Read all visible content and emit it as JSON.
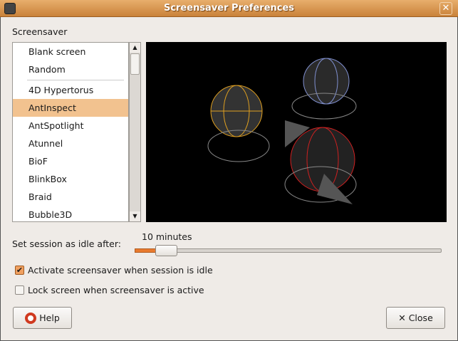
{
  "window": {
    "title": "Screensaver Preferences"
  },
  "section_label": "Screensaver",
  "screensavers": {
    "items": [
      "Blank screen",
      "Random",
      "4D Hypertorus",
      "AntInspect",
      "AntSpotlight",
      "Atunnel",
      "BioF",
      "BlinkBox",
      "Braid",
      "Bubble3D"
    ],
    "selected": "AntInspect"
  },
  "idle": {
    "label": "Set session as idle after:",
    "value_text": "10 minutes",
    "value_minutes": 10,
    "fraction": 0.07
  },
  "activate_checkbox": {
    "label": "Activate screensaver when session is idle",
    "checked": true
  },
  "lock_checkbox": {
    "label": "Lock screen when screensaver is active",
    "checked": false
  },
  "buttons": {
    "help": "Help",
    "close": "Close"
  },
  "colors": {
    "accent": "#e87a2e",
    "titlebar": "#d49050",
    "selection": "#f2c28f"
  }
}
